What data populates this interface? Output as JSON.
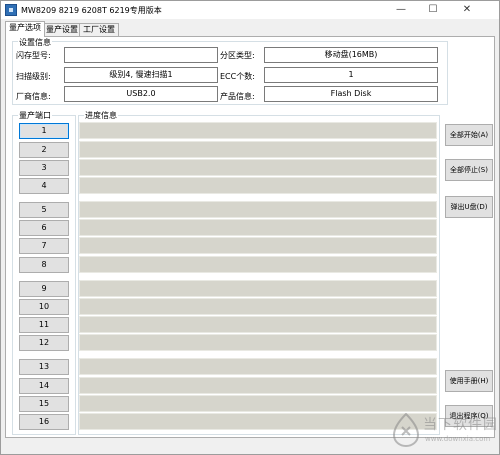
{
  "window": {
    "title": "MW8209 8219 6208T 6219专用版本",
    "minimize_glyph": "—",
    "maximize_glyph": "☐",
    "close_glyph": "✕"
  },
  "tabs": [
    {
      "label": "量产选项",
      "active": true
    },
    {
      "label": "量产设置",
      "active": false
    },
    {
      "label": "工厂设置",
      "active": false
    }
  ],
  "settings": {
    "group_label": "设置信息",
    "flash_model_label": "闪存型号:",
    "flash_model_value": "",
    "partition_type_label": "分区类型:",
    "partition_type_value": "移动盘(16MB)",
    "scan_level_label": "扫描级别:",
    "scan_level_value": "级别4, 慢速扫描1",
    "ecc_label": "ECC个数:",
    "ecc_value": "1",
    "vendor_label": "厂商信息:",
    "vendor_value": "USB2.0",
    "product_label": "产品信息:",
    "product_value": "Flash Disk"
  },
  "ports": {
    "group_label": "量产端口",
    "items": [
      "1",
      "2",
      "3",
      "4",
      "5",
      "6",
      "7",
      "8",
      "9",
      "10",
      "11",
      "12",
      "13",
      "14",
      "15",
      "16"
    ]
  },
  "progress": {
    "group_label": "进度信息",
    "values": [
      0,
      0,
      0,
      0,
      0,
      0,
      0,
      0,
      0,
      0,
      0,
      0,
      0,
      0,
      0,
      0
    ]
  },
  "actions": {
    "start_all": "全部开始(A)",
    "stop_all": "全部停止(S)",
    "eject": "弹出U盘(D)",
    "manual": "使用手册(H)",
    "exit": "退出程序(Q)"
  },
  "watermark": {
    "brand": "当下软件园",
    "url": "www.downxia.com"
  },
  "colors": {
    "progress_track": "#d6d5cc",
    "progress_fill": "#06b025",
    "focus_border": "#0078d7"
  }
}
